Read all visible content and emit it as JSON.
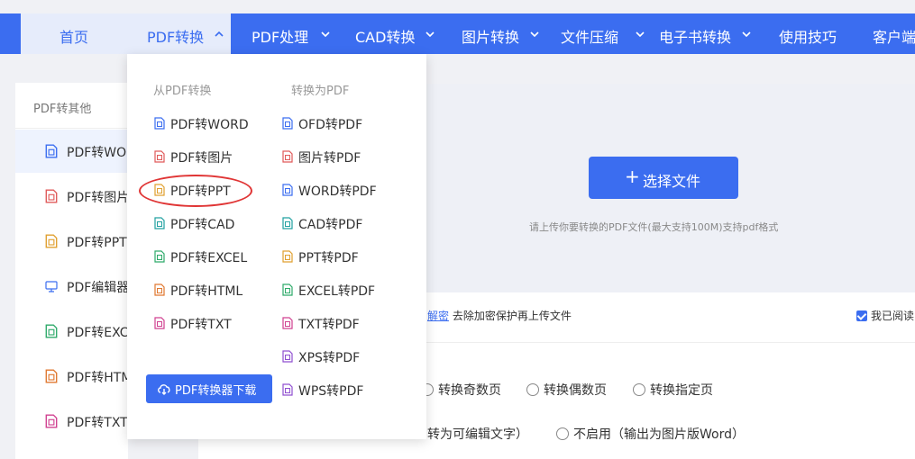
{
  "nav": {
    "home": "首页",
    "items": [
      "PDF转换",
      "PDF处理",
      "CAD转换",
      "图片转换",
      "文件压缩",
      "电子书转换",
      "使用技巧",
      "客户端"
    ]
  },
  "sidebar": {
    "title": "PDF转其他",
    "items": [
      {
        "label": "PDF转WORD",
        "icon": "word-file-icon",
        "color": "#3b6df0"
      },
      {
        "label": "PDF转图片",
        "icon": "image-file-icon",
        "color": "#e05a5a"
      },
      {
        "label": "PDF转PPT",
        "icon": "ppt-file-icon",
        "color": "#e0a030"
      },
      {
        "label": "PDF编辑器",
        "icon": "monitor-icon",
        "color": "#3b6df0"
      },
      {
        "label": "PDF转EXCEL",
        "icon": "excel-file-icon",
        "color": "#2eaa6a"
      },
      {
        "label": "PDF转HTML",
        "icon": "html-file-icon",
        "color": "#e07830"
      },
      {
        "label": "PDF转TXT",
        "icon": "txt-file-icon",
        "color": "#d04090"
      }
    ]
  },
  "dropdown": {
    "from_title": "从PDF转换",
    "to_title": "转换为PDF",
    "from_items": [
      {
        "label": "PDF转WORD",
        "icon": "word-file-icon",
        "color": "#3b6df0"
      },
      {
        "label": "PDF转图片",
        "icon": "image-file-icon",
        "color": "#e05a5a"
      },
      {
        "label": "PDF转PPT",
        "icon": "ppt-file-icon",
        "color": "#e0a030"
      },
      {
        "label": "PDF转CAD",
        "icon": "cad-file-icon",
        "color": "#20a0a0"
      },
      {
        "label": "PDF转EXCEL",
        "icon": "excel-file-icon",
        "color": "#2eaa6a"
      },
      {
        "label": "PDF转HTML",
        "icon": "html-file-icon",
        "color": "#e07830"
      },
      {
        "label": "PDF转TXT",
        "icon": "txt-file-icon",
        "color": "#d04090"
      }
    ],
    "to_items": [
      {
        "label": "OFD转PDF",
        "icon": "ofd-file-icon",
        "color": "#3b6df0"
      },
      {
        "label": "图片转PDF",
        "icon": "image-file-icon",
        "color": "#e05a5a"
      },
      {
        "label": "WORD转PDF",
        "icon": "word-file-icon",
        "color": "#3b6df0"
      },
      {
        "label": "CAD转PDF",
        "icon": "cad-file-icon",
        "color": "#20a0a0"
      },
      {
        "label": "PPT转PDF",
        "icon": "ppt-file-icon",
        "color": "#e0a030"
      },
      {
        "label": "EXCEL转PDF",
        "icon": "excel-file-icon",
        "color": "#2eaa6a"
      },
      {
        "label": "TXT转PDF",
        "icon": "txt-file-icon",
        "color": "#d04090"
      },
      {
        "label": "XPS转PDF",
        "icon": "xps-file-icon",
        "color": "#9050d0"
      },
      {
        "label": "WPS转PDF",
        "icon": "wps-file-icon",
        "color": "#9050d0"
      }
    ],
    "download_label": "PDF转换器下载"
  },
  "upload": {
    "button_label": "选择文件",
    "tip": "请上传你要转换的PDF文件(最大支持100M)支持pdf格式",
    "decrypt_link": "解密",
    "decrypt_text": "去除加密保护再上传文件",
    "agree_text": "我已阅读"
  },
  "options": {
    "pages": [
      "转换奇数页",
      "转换偶数页",
      "转换指定页"
    ],
    "ocr_partial": "转为可编辑文字）",
    "ocr_disabled": "不启用（输出为图片版Word）"
  },
  "colors": {
    "primary": "#3b6df0",
    "highlight": "#e03535"
  }
}
